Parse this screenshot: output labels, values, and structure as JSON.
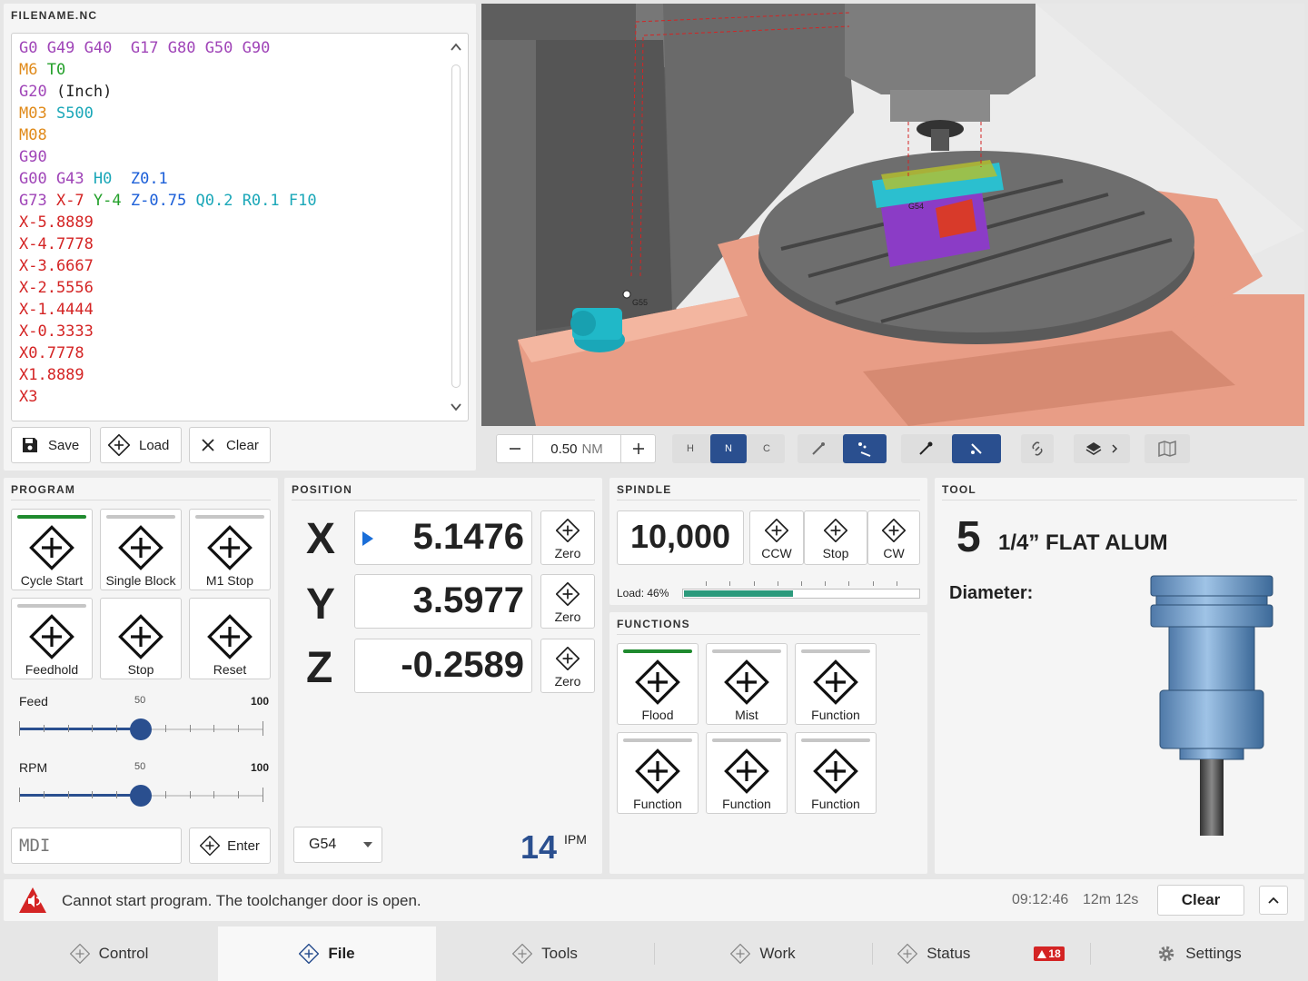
{
  "editor": {
    "filename": "FILENAME.NC",
    "lines": [
      [
        {
          "t": "G0 G49 G40  G17 G80 G50 G90",
          "c": "purple"
        }
      ],
      [
        {
          "t": "M6 ",
          "c": "orange"
        },
        {
          "t": "T0",
          "c": "green"
        }
      ],
      [
        {
          "t": "G20 ",
          "c": "purple"
        },
        {
          "t": "(Inch)",
          "c": "dark"
        }
      ],
      [
        {
          "t": "M03 ",
          "c": "orange"
        },
        {
          "t": "S500",
          "c": "teal"
        }
      ],
      [
        {
          "t": "M08",
          "c": "orange"
        }
      ],
      [
        {
          "t": "G90",
          "c": "purple"
        }
      ],
      [
        {
          "t": "G00 G43 ",
          "c": "purple"
        },
        {
          "t": "H0  ",
          "c": "teal"
        },
        {
          "t": "Z0.1",
          "c": "blue"
        }
      ],
      [
        {
          "t": "G73 ",
          "c": "purple"
        },
        {
          "t": "X-7 ",
          "c": "red"
        },
        {
          "t": "Y-4 ",
          "c": "green"
        },
        {
          "t": "Z-0.75 ",
          "c": "blue"
        },
        {
          "t": "Q0.2 R0.1 F10",
          "c": "teal"
        }
      ],
      [
        {
          "t": "X-5.8889",
          "c": "red"
        }
      ],
      [
        {
          "t": "X-4.7778",
          "c": "red"
        }
      ],
      [
        {
          "t": "X-3.6667",
          "c": "red"
        }
      ],
      [
        {
          "t": "X-2.5556",
          "c": "red"
        }
      ],
      [
        {
          "t": "X-1.4444",
          "c": "red"
        }
      ],
      [
        {
          "t": "X-0.3333",
          "c": "red"
        }
      ],
      [
        {
          "t": "X0.7778",
          "c": "red"
        }
      ],
      [
        {
          "t": "X1.8889",
          "c": "red"
        }
      ],
      [
        {
          "t": "X3",
          "c": "red"
        }
      ]
    ],
    "save_label": "Save",
    "load_label": "Load",
    "clear_label": "Clear"
  },
  "viewport_toolbar": {
    "zoom_value": "0.50",
    "zoom_unit": "NM",
    "view_h": "H",
    "view_n": "N",
    "view_c": "C",
    "tag_g55": "G55",
    "tag_g54": "G54"
  },
  "program": {
    "title": "PROGRAM",
    "tiles": [
      {
        "label": "Cycle Start",
        "active": true
      },
      {
        "label": "Single Block",
        "active": false
      },
      {
        "label": "M1 Stop",
        "active": false
      },
      {
        "label": "Feedhold",
        "active": false
      },
      {
        "label": "Stop"
      },
      {
        "label": "Reset"
      }
    ],
    "feed_label": "Feed",
    "feed_mid": "50",
    "feed_max": "100",
    "feed_value": 50,
    "rpm_label": "RPM",
    "rpm_mid": "50",
    "rpm_max": "100",
    "rpm_value": 50,
    "mdi_placeholder": "MDI",
    "enter_label": "Enter"
  },
  "position": {
    "title": "POSITION",
    "axes": [
      {
        "axis": "X",
        "value": "5.1476",
        "zero": "Zero"
      },
      {
        "axis": "Y",
        "value": "3.5977",
        "zero": "Zero"
      },
      {
        "axis": "Z",
        "value": "-0.2589",
        "zero": "Zero"
      }
    ],
    "wcs": "G54",
    "feed_value": "14",
    "feed_unit": "IPM"
  },
  "spindle": {
    "title": "SPINDLE",
    "rpm": "10,000",
    "ccw_label": "CCW",
    "stop_label": "Stop",
    "cw_label": "CW",
    "load_label": "Load: 46%",
    "load_fraction": 0.46
  },
  "functions": {
    "title": "FUNCTIONS",
    "tiles": [
      {
        "label": "Flood",
        "active": true
      },
      {
        "label": "Mist",
        "active": false
      },
      {
        "label": "Function",
        "active": false
      },
      {
        "label": "Function",
        "active": false
      },
      {
        "label": "Function",
        "active": false
      },
      {
        "label": "Function",
        "active": false
      }
    ]
  },
  "tool": {
    "title": "TOOL",
    "number": "5",
    "name": "1/4” FLAT ALUM",
    "diameter_label": "Diameter:"
  },
  "status_bar": {
    "message": "Cannot start program. The toolchanger door is open.",
    "time": "09:12:46",
    "elapsed": "12m 12s",
    "clear_label": "Clear"
  },
  "nav": {
    "items": [
      "Control",
      "File",
      "Tools",
      "Work",
      "Status",
      "Settings"
    ],
    "active": "File",
    "status_badge": "18"
  },
  "colors": {
    "accent": "#2a4f8f",
    "active_green": "#1f8a2e",
    "alert_red": "#d42424",
    "load_green": "#2c9a7c"
  }
}
